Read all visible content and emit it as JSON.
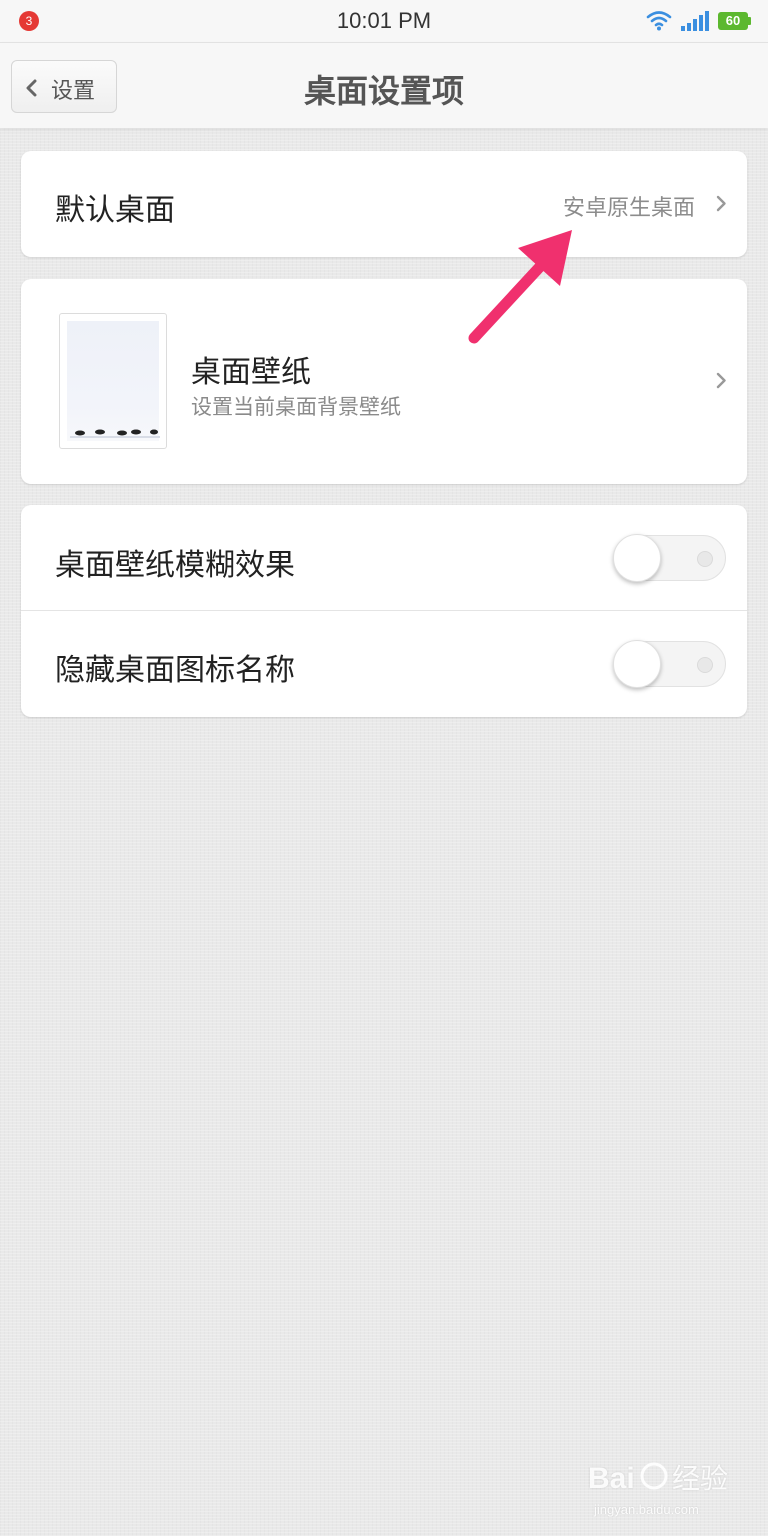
{
  "status_bar": {
    "notification_count": "3",
    "time": "10:01 PM",
    "battery": "60",
    "icons": [
      "wifi-icon",
      "signal-icon",
      "battery-icon"
    ]
  },
  "header": {
    "back_label": "设置",
    "title": "桌面设置项"
  },
  "default_launcher": {
    "label": "默认桌面",
    "value": "安卓原生桌面"
  },
  "wallpaper": {
    "label": "桌面壁纸",
    "subtitle": "设置当前桌面背景壁纸"
  },
  "toggles": [
    {
      "label": "桌面壁纸模糊效果",
      "on": false
    },
    {
      "label": "隐藏桌面图标名称",
      "on": false
    }
  ],
  "annotation": {
    "color": "#f0306e",
    "shape": "arrow"
  },
  "colors": {
    "accent_battery": "#5cb82f",
    "badge": "#e53935"
  }
}
